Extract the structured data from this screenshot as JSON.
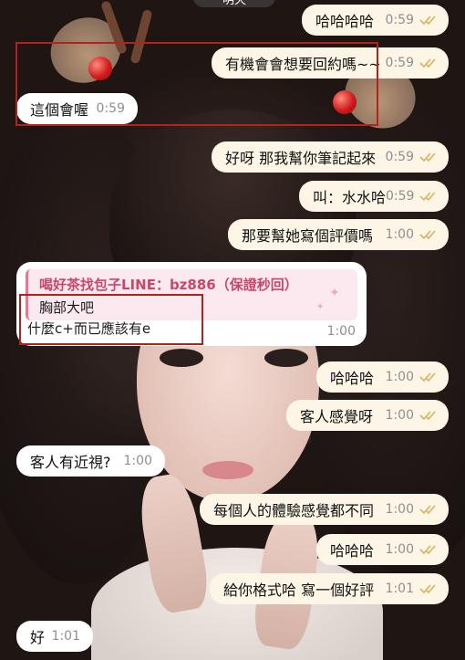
{
  "header": {
    "date_label": "明天"
  },
  "messages": [
    {
      "id": "m1",
      "dir": "out",
      "text": "哈哈哈哈",
      "time": "0:59",
      "read": true
    },
    {
      "id": "m2",
      "dir": "out",
      "text": "有機會會想要回約嗎~~",
      "time": "0:59",
      "read": true
    },
    {
      "id": "m3",
      "dir": "in",
      "text": "這個會喔",
      "time": "0:59"
    },
    {
      "id": "m4",
      "dir": "out",
      "text": "好呀 那我幫你筆記起來",
      "time": "0:59",
      "read": true
    },
    {
      "id": "m5",
      "dir": "out",
      "text": "叫：水水哈",
      "time": "0:59",
      "read": true
    },
    {
      "id": "m6",
      "dir": "out",
      "text": "那要幫她寫個評價嗎",
      "time": "1:00",
      "read": true
    },
    {
      "id": "m7",
      "dir": "in",
      "quote_title": "喝好茶找包子LINE：bz886（保證秒回）",
      "quote_text": "胸部大吧",
      "text": "什麼c+而已應該有e",
      "time": "1:00"
    },
    {
      "id": "m8",
      "dir": "out",
      "text": "哈哈哈",
      "time": "1:00",
      "read": true
    },
    {
      "id": "m9",
      "dir": "out",
      "text": "客人感覺呀",
      "time": "1:00",
      "read": true
    },
    {
      "id": "m10",
      "dir": "in",
      "text": "客人有近視?",
      "time": "1:00"
    },
    {
      "id": "m11",
      "dir": "out",
      "text": "每個人的體驗感覺都不同",
      "time": "1:00",
      "read": true
    },
    {
      "id": "m12",
      "dir": "out",
      "text": "哈哈哈",
      "time": "1:00",
      "read": true
    },
    {
      "id": "m13",
      "dir": "out",
      "text": "給你格式哈 寫一個好評",
      "time": "1:01",
      "read": true
    },
    {
      "id": "m14",
      "dir": "in",
      "text": "好",
      "time": "1:01"
    }
  ],
  "colors": {
    "outgoing_bubble": "#fdf6e7",
    "incoming_bubble": "#ffffff",
    "read_ticks": "#d9b15c",
    "highlight_box": "#b4221d",
    "quote_accent": "#e8778f"
  },
  "icons": {
    "read_receipt": "double-check-icon",
    "sparkle": "sparkle-icon"
  }
}
